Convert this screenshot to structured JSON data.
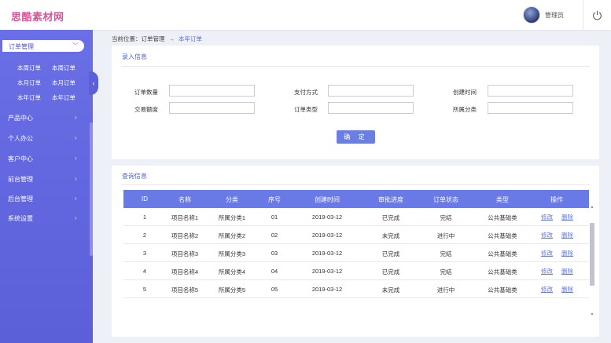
{
  "header": {
    "logo": "思酷素材网",
    "user_name": "管理员"
  },
  "sidebar": {
    "active_group": "订单管理",
    "sub_items": [
      "本周订单",
      "本周订单",
      "本月订单",
      "本月订单",
      "本年订单",
      "本年订单"
    ],
    "nav_items": [
      "产品中心",
      "个人办公",
      "客户中心",
      "前台管理",
      "后台管理",
      "系统设置"
    ]
  },
  "breadcrumb": {
    "prefix": "当前位置：",
    "parent": "订单管理",
    "separator": "→",
    "current": "本年订单"
  },
  "entry_panel": {
    "title": "录入信息",
    "fields": [
      {
        "label": "订单数量",
        "value": ""
      },
      {
        "label": "支付方式",
        "value": ""
      },
      {
        "label": "创建时间",
        "value": ""
      },
      {
        "label": "交易额度",
        "value": ""
      },
      {
        "label": "订单类型",
        "value": ""
      },
      {
        "label": "所属分类",
        "value": ""
      }
    ],
    "confirm_label": "确 定"
  },
  "query_panel": {
    "title": "查询信息",
    "columns": [
      "ID",
      "名称",
      "分类",
      "序号",
      "创建时间",
      "审批进度",
      "订单状态",
      "类型",
      "操作"
    ],
    "edit_label": "修改",
    "delete_label": "删除",
    "rows": [
      [
        "1",
        "项目名称1",
        "所属分类1",
        "01",
        "2019-03-12",
        "已完成",
        "完结",
        "公共基础类"
      ],
      [
        "2",
        "项目名称2",
        "所属分类2",
        "02",
        "2019-03-12",
        "未完成",
        "进行中",
        "公共基础类"
      ],
      [
        "3",
        "项目名称3",
        "所属分类3",
        "03",
        "2019-03-12",
        "已完成",
        "完结",
        "公共基础类"
      ],
      [
        "4",
        "项目名称4",
        "所属分类4",
        "04",
        "2019-03-12",
        "已完成",
        "完结",
        "公共基础类"
      ],
      [
        "5",
        "项目名称5",
        "所属分类5",
        "05",
        "2019-03-12",
        "未完成",
        "进行中",
        "公共基础类"
      ]
    ]
  },
  "colors": {
    "sidebar": "#5b5fd8",
    "accent": "#6979e6",
    "logo": "#e0529b"
  }
}
